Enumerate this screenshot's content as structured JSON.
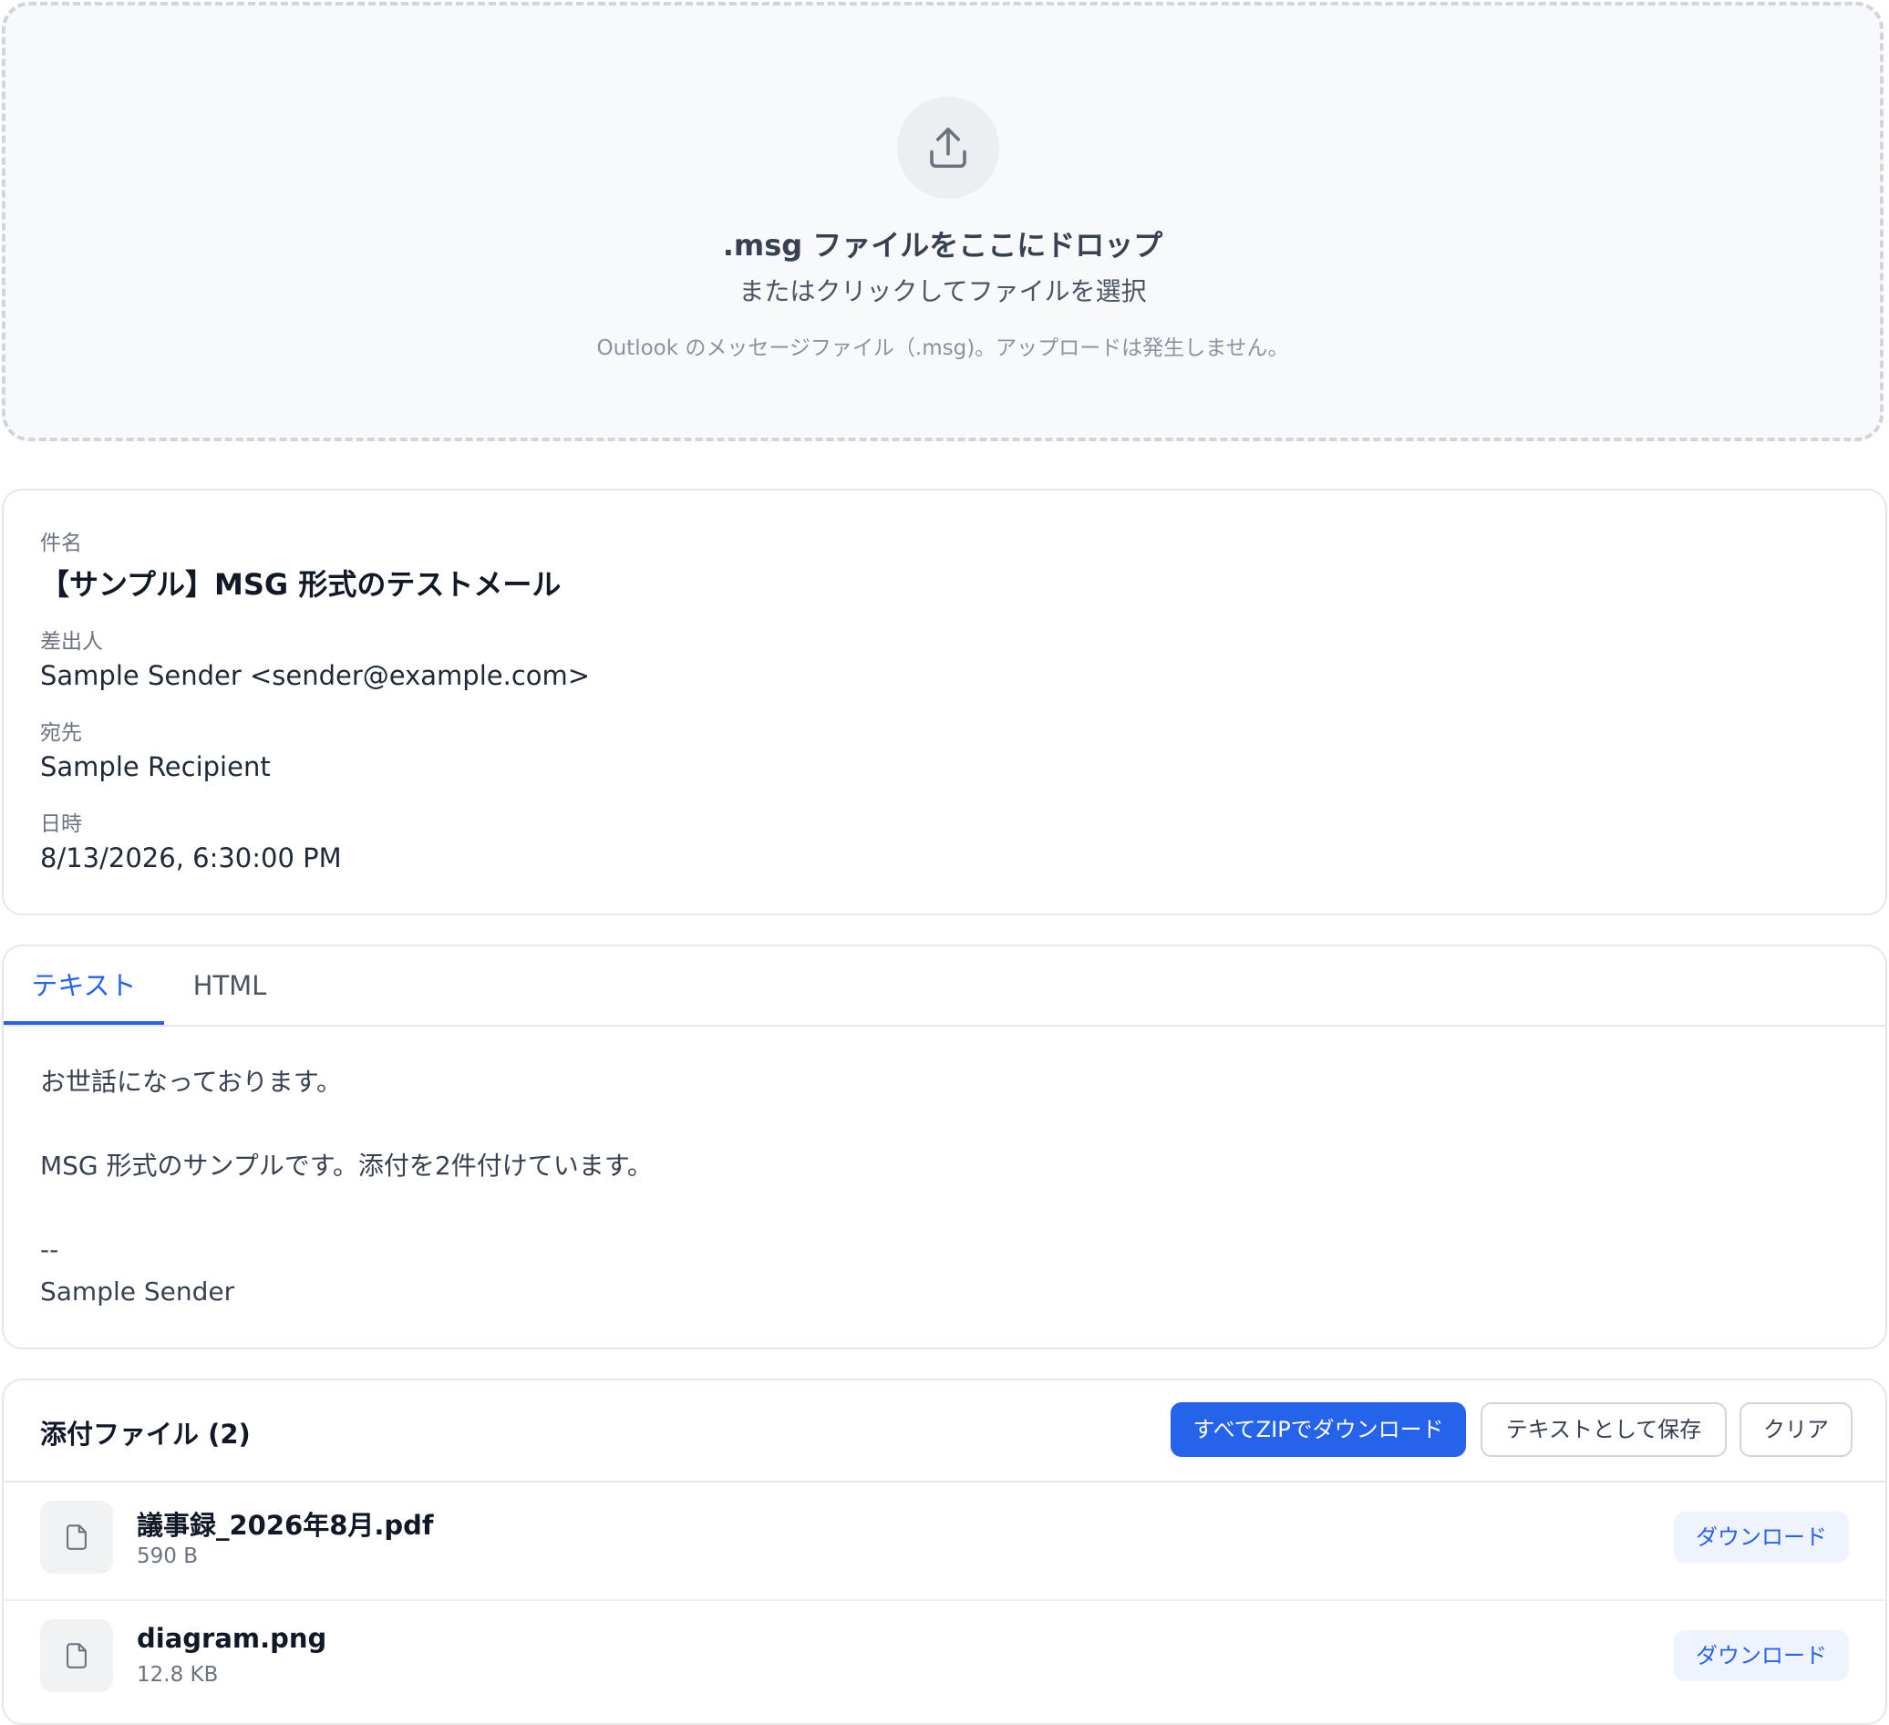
{
  "dropzone": {
    "icon": "upload-icon",
    "title": ".msg ファイルをここにドロップ",
    "subtitle": "またはクリックしてファイルを選択",
    "hint": "Outlook のメッセージファイル（.msg)。アップロードは発生しません。"
  },
  "meta": {
    "subject_label": "件名",
    "subject": "【サンプル】MSG 形式のテストメール",
    "from_label": "差出人",
    "from": "Sample Sender <sender@example.com>",
    "to_label": "宛先",
    "to": "Sample Recipient",
    "date_label": "日時",
    "date": "8/13/2026, 6:30:00 PM"
  },
  "tabs": [
    {
      "label": "テキスト",
      "active": true
    },
    {
      "label": "HTML",
      "active": false
    }
  ],
  "body_lines": [
    "お世話になっております。",
    "",
    "MSG 形式のサンプルです。添付を2件付けています。",
    "",
    "--",
    "Sample Sender"
  ],
  "attachments": {
    "title": "添付ファイル (2)",
    "zip_label": "すべてZIPでダウンロード",
    "save_label": "テキストとして保存",
    "clear_label": "クリア",
    "items": [
      {
        "name": "議事録_2026年8月.pdf",
        "size": "590 B",
        "icon": "file-icon",
        "action": "ダウンロード"
      },
      {
        "name": "diagram.png",
        "size": "12.8 KB",
        "icon": "file-icon",
        "action": "ダウンロード"
      }
    ]
  },
  "colors": {
    "accent": "#2563eb",
    "border": "#e5e7eb",
    "muted_text": "#6b7280"
  }
}
